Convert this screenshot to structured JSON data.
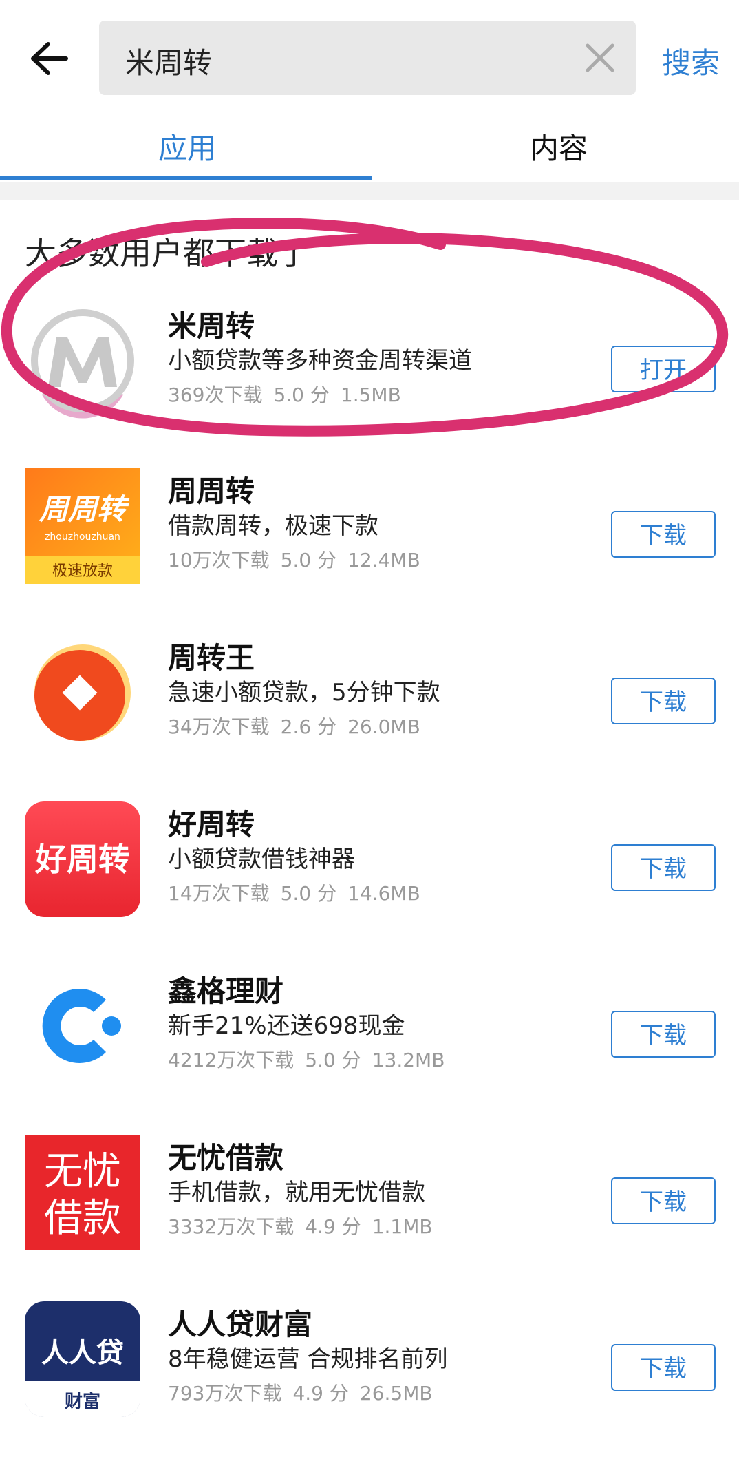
{
  "search": {
    "query": "米周转",
    "button_label": "搜索"
  },
  "tabs": [
    {
      "label": "应用"
    },
    {
      "label": "内容"
    }
  ],
  "section_title": "大多数用户都下载了",
  "colors": {
    "accent": "#2e7fd2",
    "annotation": "#d9306f"
  },
  "apps": [
    {
      "name": "米周转",
      "description": "小额贷款等多种资金周转渠道",
      "downloads": "369次下载",
      "rating": "5.0 分",
      "size": "1.5MB",
      "action": "打开",
      "icon": "mi-zhouzhuan-logo"
    },
    {
      "name": "周周转",
      "description": "借款周转，极速下款",
      "downloads": "10万次下载",
      "rating": "5.0 分",
      "size": "12.4MB",
      "action": "下载",
      "icon": "zhouzhouzhuan-logo",
      "icon_text": "周周转",
      "icon_sub": "zhouzhouzhuan",
      "icon_badge": "极速放款"
    },
    {
      "name": "周转王",
      "description": "急速小额贷款，5分钟下款",
      "downloads": "34万次下载",
      "rating": "2.6 分",
      "size": "26.0MB",
      "action": "下载",
      "icon": "zhouzhuanwang-logo"
    },
    {
      "name": "好周转",
      "description": "小额贷款借钱神器",
      "downloads": "14万次下载",
      "rating": "5.0 分",
      "size": "14.6MB",
      "action": "下载",
      "icon": "haozhouzhuan-logo",
      "icon_text": "好周转"
    },
    {
      "name": "鑫格理财",
      "description": "新手21%还送698现金",
      "downloads": "4212万次下载",
      "rating": "5.0 分",
      "size": "13.2MB",
      "action": "下载",
      "icon": "xinge-logo"
    },
    {
      "name": "无忧借款",
      "description": "手机借款，就用无忧借款",
      "downloads": "3332万次下载",
      "rating": "4.9 分",
      "size": "1.1MB",
      "action": "下载",
      "icon": "wuyou-logo",
      "icon_text_1": "无忧",
      "icon_text_2": "借款"
    },
    {
      "name": "人人贷财富",
      "description": "8年稳健运营 合规排名前列",
      "downloads": "793万次下载",
      "rating": "4.9 分",
      "size": "26.5MB",
      "action": "下载",
      "icon": "renrendai-logo",
      "icon_text": "人人贷",
      "icon_sub": "财富"
    }
  ]
}
